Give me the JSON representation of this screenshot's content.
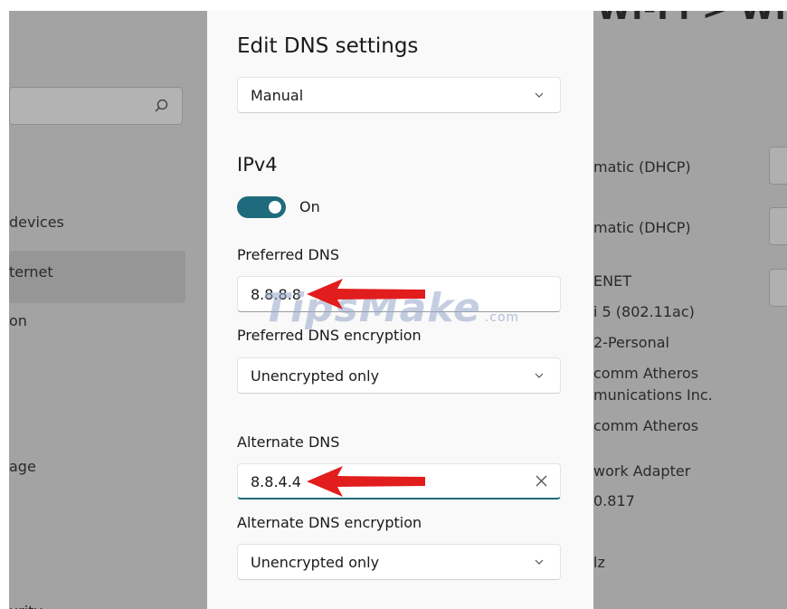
{
  "background_page": {
    "title_partial": "Wi-Fi  >  Wi-Fi",
    "search_icon": "search-icon",
    "nav_items": [
      "devices",
      "ternet",
      "on",
      "age",
      "urity"
    ],
    "properties": [
      "matic (DHCP)",
      "matic (DHCP)",
      "ENET",
      "i 5 (802.11ac)",
      "2-Personal",
      "comm Atheros",
      "munications Inc.",
      "comm Atheros",
      "work Adapter",
      "0.817",
      "lz"
    ]
  },
  "dialog": {
    "title": "Edit DNS settings",
    "mode_select": {
      "value": "Manual",
      "icon": "chevron-down-icon"
    },
    "ipv4": {
      "heading": "IPv4",
      "toggle_state": "On",
      "toggle_on": true,
      "preferred_dns_label": "Preferred DNS",
      "preferred_dns_value": "8.8.8.8",
      "preferred_encryption_label": "Preferred DNS encryption",
      "preferred_encryption_value": "Unencrypted only",
      "alternate_dns_label": "Alternate DNS",
      "alternate_dns_value": "8.8.4.4",
      "alternate_encryption_label": "Alternate DNS encryption",
      "alternate_encryption_value": "Unencrypted only"
    }
  },
  "watermark": {
    "text": "TipsMake",
    "suffix": ".com"
  },
  "colors": {
    "accent": "#1f6a7c",
    "overlay_background": "#a3a3a3",
    "dialog_background": "#f9f9f9",
    "annotation_arrow": "#e11d1d"
  }
}
